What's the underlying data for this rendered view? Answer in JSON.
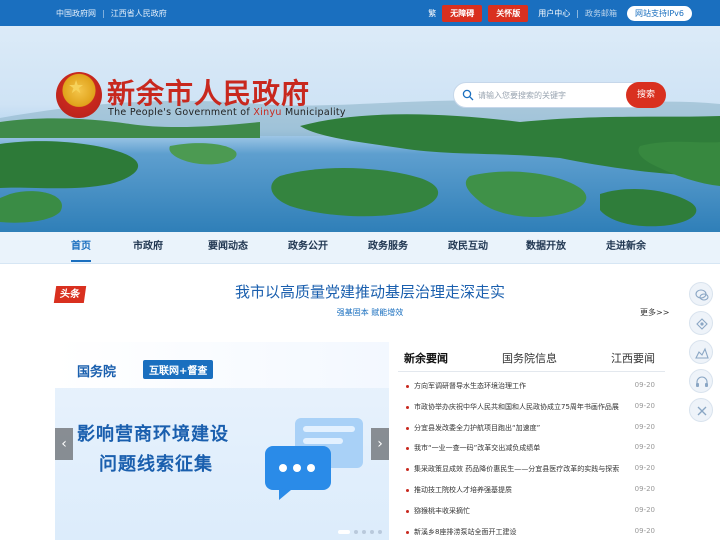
{
  "topbar": {
    "links": [
      "中国政府网",
      "江西省人民政府"
    ],
    "traditional": "繁",
    "accessible": "无障碍",
    "elder": "关怀版",
    "user_center": "用户中心",
    "gov_mail": "政务邮箱",
    "ipv6": "网站支持IPv6"
  },
  "header": {
    "title": "新余市人民政府",
    "subtitle_prefix": "The People's Government of ",
    "subtitle_highlight": "Xinyu",
    "subtitle_suffix": " Municipality",
    "search_placeholder": "请输入您要搜索的关键字",
    "search_button": "搜索"
  },
  "nav": [
    "首页",
    "市政府",
    "要闻动态",
    "政务公开",
    "政务服务",
    "政民互动",
    "数据开放",
    "走进新余"
  ],
  "headline": {
    "tag": "头条",
    "title": "我市以高质量党建推动基层治理走深走实",
    "subtitle": "强基固本 赋能增效",
    "more": "更多>>"
  },
  "slide": {
    "org": "国务院",
    "tag": "互联网+督查",
    "line1": "影响营商环境建设",
    "line2": "问题线索征集"
  },
  "news": {
    "tabs": [
      "新余要闻",
      "国务院信息",
      "江西要闻"
    ],
    "items": [
      {
        "title": "方向军调研督导水生态环境治理工作",
        "date": "09-20"
      },
      {
        "title": "市政协举办庆祝中华人民共和国和人民政协成立75周年书画作品展",
        "date": "09-20"
      },
      {
        "title": "分宜县发改委全力护航项目跑出“加速度”",
        "date": "09-20"
      },
      {
        "title": "我市“一业一查一码”改革交出减负成绩单",
        "date": "09-20"
      },
      {
        "title": "集采政策显成效 药品降价惠民生——分宜县医疗改革的实践与探索",
        "date": "09-20"
      },
      {
        "title": "推动技工院校人才培养强基提质",
        "date": "09-20"
      },
      {
        "title": "猕猴桃丰收采摘忙",
        "date": "09-20"
      },
      {
        "title": "新溪乡8座排涝泵站全面开工建设",
        "date": "09-20"
      }
    ]
  },
  "icons": {
    "side": [
      "wechat-icon",
      "weibo-icon",
      "app-icon",
      "headset-icon",
      "close-icon"
    ]
  },
  "colors": {
    "brand_blue": "#1a6fbf",
    "brand_red": "#d9301f"
  }
}
